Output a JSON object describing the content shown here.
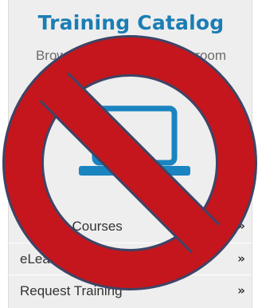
{
  "catalog": {
    "title": "Training Catalog",
    "subtitle": "Browse eLearning & Classroom",
    "icon": "laptop-icon"
  },
  "menu": {
    "items": [
      {
        "label": "Training Courses",
        "icon": "double-chevron-right-icon",
        "arrow": "»"
      },
      {
        "label": "eLearning",
        "icon": "double-chevron-right-icon",
        "arrow": "»"
      },
      {
        "label": "Request Training",
        "icon": "double-chevron-right-icon",
        "arrow": "»"
      }
    ]
  },
  "overlay": {
    "icon": "prohibited-icon",
    "color": "#c4161c",
    "outline_color": "#3e4466"
  },
  "colors": {
    "title": "#1b7db5",
    "icon": "#1a84c0",
    "card_background": "#eeeeee"
  }
}
